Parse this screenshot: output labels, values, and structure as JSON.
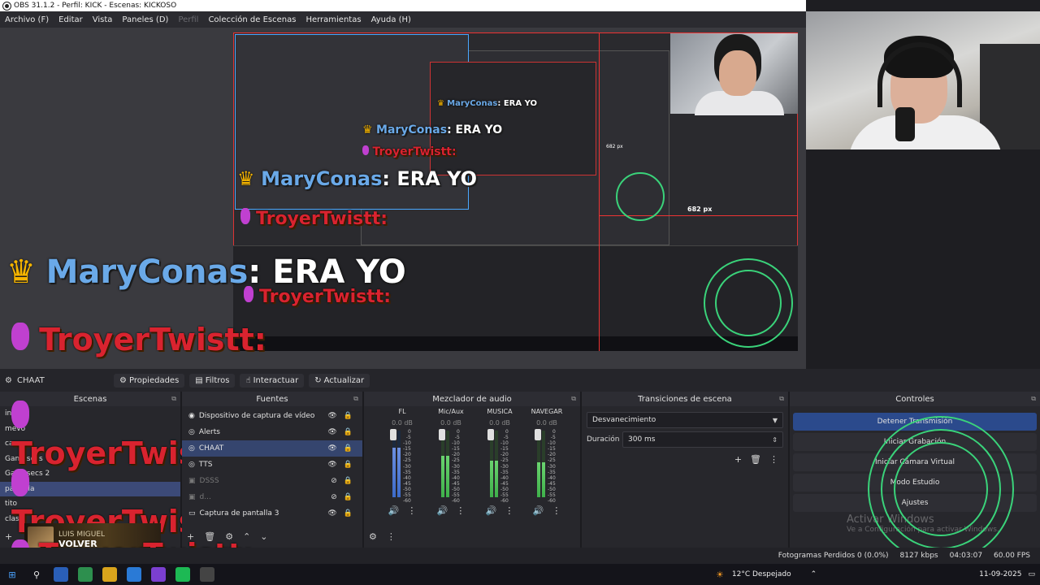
{
  "window": {
    "title": "OBS 31.1.2 - Perfil: KICK - Escenas: KICKOSO"
  },
  "menu": [
    "Archivo (F)",
    "Editar",
    "Vista",
    "Paneles (D)",
    "Perfil",
    "Colección de Escenas",
    "Herramientas",
    "Ayuda (H)"
  ],
  "preview": {
    "size_label": "682 px",
    "size_label_inner": "682 px",
    "chat": {
      "user": "MaryConas",
      "message": ": ERA YO",
      "troyer": "TroyerTwistt:"
    }
  },
  "toolbar": {
    "scene_name": "CHAAT",
    "buttons": [
      "Propiedades",
      "Filtros",
      "Interactuar",
      "Actualizar"
    ]
  },
  "scenes": {
    "title": "Escenas",
    "items": [
      "intro",
      "mevo",
      "cam",
      "Gamesecs",
      "Gamesecs 2",
      "pantalla",
      "tito",
      "clash"
    ],
    "selected_index": 5
  },
  "sources": {
    "title": "Fuentes",
    "items": [
      {
        "name": "Dispositivo de captura de vídeo",
        "dim": false
      },
      {
        "name": "Alerts",
        "dim": false
      },
      {
        "name": "CHAAT",
        "dim": false
      },
      {
        "name": "TTS",
        "dim": false
      },
      {
        "name": "DSSS",
        "dim": true
      },
      {
        "name": "d...",
        "dim": true
      },
      {
        "name": "Captura de pantalla 3",
        "dim": false
      }
    ],
    "selected_index": 2
  },
  "mixer": {
    "title": "Mezclador de audio",
    "channels": [
      {
        "name": "FL",
        "db": "0.0 dB",
        "level": 0.75,
        "color": "blue"
      },
      {
        "name": "Mic/Aux",
        "db": "0.0 dB",
        "level": 0.62,
        "color": "green"
      },
      {
        "name": "MUSICA",
        "db": "0.0 dB",
        "level": 0.55,
        "color": "green"
      },
      {
        "name": "NAVEGAR",
        "db": "0.0 dB",
        "level": 0.52,
        "color": "green"
      }
    ],
    "scale": [
      "0",
      "-5",
      "-10",
      "-15",
      "-20",
      "-25",
      "-30",
      "-35",
      "-40",
      "-45",
      "-50",
      "-55",
      "-60"
    ]
  },
  "transitions": {
    "title": "Transiciones de escena",
    "selected": "Desvanecimiento",
    "duration_label": "Duración",
    "duration_value": "300 ms"
  },
  "controls": {
    "title": "Controles",
    "buttons": [
      "Detener Transmisión",
      "Iniciar Grabación",
      "Iniciar Cámara Virtual",
      "Modo Estudio",
      "Ajustes"
    ]
  },
  "now_playing": {
    "artist": "LUIS MIGUEL",
    "song": "VOLVER"
  },
  "watermark": {
    "title": "Activar Windows",
    "subtitle": "Ve a Configuración para activar Windows."
  },
  "status": {
    "dropped": "Fotogramas Perdidos 0 (0.0%)",
    "bitrate": "8127 kbps",
    "time": "04:03:07",
    "fps": "60.00 FPS"
  },
  "taskbar": {
    "weather": "12°C  Despejado",
    "date": "11-09-2025"
  },
  "colors": {
    "accent": "#2b4a8c",
    "selection": "#3c4a78",
    "troyer": "#d9232f",
    "maryconas": "#6aa9e8",
    "ring": "#3ad37a"
  }
}
